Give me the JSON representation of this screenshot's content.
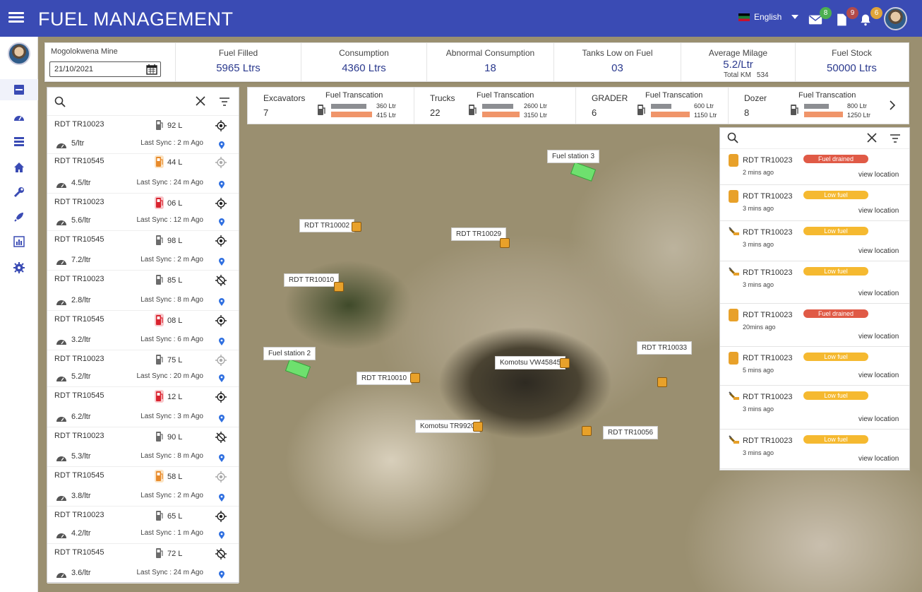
{
  "header": {
    "title": "FUEL MANAGEMENT",
    "language": "English",
    "badges": {
      "mail": "8",
      "docs": "9",
      "alerts": "6"
    }
  },
  "colors": {
    "primary": "#3a4bb4",
    "value": "#2b3a8e",
    "badge_mail": "#4caf50",
    "badge_docs": "#b24a4a",
    "badge_alerts": "#e0a43a",
    "fuel_drained": "#e05a46",
    "low_fuel": "#f5b930"
  },
  "sidebar": {
    "items": [
      {
        "icon": "list-icon"
      },
      {
        "icon": "dashboard-gauge-icon"
      },
      {
        "icon": "stack-icon"
      },
      {
        "icon": "home-icon"
      },
      {
        "icon": "wrench-icon"
      },
      {
        "icon": "rocket-icon"
      },
      {
        "icon": "bar-chart-icon"
      },
      {
        "icon": "gear-icon"
      }
    ]
  },
  "summary": {
    "mine": "Mogolokwena Mine",
    "date": "21/10/2021",
    "fuel_filled": {
      "label": "Fuel Filled",
      "value": "5965 Ltrs"
    },
    "consumption": {
      "label": "Consumption",
      "value": "4360 Ltrs"
    },
    "abnormal": {
      "label": "Abnormal Consumption",
      "value": "18"
    },
    "tanks_low": {
      "label": "Tanks Low on Fuel",
      "value": "03"
    },
    "avg_milage": {
      "label": "Average Milage",
      "value": "5.2/Ltr",
      "total_label": "Total KM",
      "total_value": "534"
    },
    "fuel_stock": {
      "label": "Fuel Stock",
      "value": "50000 Ltrs"
    }
  },
  "vehicles": [
    {
      "name": "RDT TR10023",
      "fuel": "92 L",
      "level": "full",
      "milage": "5/ltr",
      "sync": "Last Sync : 2 m Ago",
      "tracking": "on"
    },
    {
      "name": "RDT TR10545",
      "fuel": "44 L",
      "level": "medium",
      "milage": "4.5/ltr",
      "sync": "Last Sync : 24 m Ago",
      "tracking": "idle"
    },
    {
      "name": "RDT TR10023",
      "fuel": "06 L",
      "level": "low",
      "milage": "5.6/ltr",
      "sync": "Last Sync : 12 m Ago",
      "tracking": "on"
    },
    {
      "name": "RDT TR10545",
      "fuel": "98 L",
      "level": "full",
      "milage": "7.2/ltr",
      "sync": "Last Sync : 2 m Ago",
      "tracking": "on"
    },
    {
      "name": "RDT TR10023",
      "fuel": "85 L",
      "level": "full",
      "milage": "2.8/ltr",
      "sync": "Last Sync : 8 m Ago",
      "tracking": "off"
    },
    {
      "name": "RDT TR10545",
      "fuel": "08 L",
      "level": "low",
      "milage": "3.2/ltr",
      "sync": "Last Sync : 6 m Ago",
      "tracking": "on"
    },
    {
      "name": "RDT TR10023",
      "fuel": "75 L",
      "level": "full",
      "milage": "5.2/ltr",
      "sync": "Last Sync : 20 m Ago",
      "tracking": "idle"
    },
    {
      "name": "RDT TR10545",
      "fuel": "12 L",
      "level": "low",
      "milage": "6.2/ltr",
      "sync": "Last Sync : 3 m Ago",
      "tracking": "on"
    },
    {
      "name": "RDT TR10023",
      "fuel": "90 L",
      "level": "full",
      "milage": "5.3/ltr",
      "sync": "Last Sync : 8 m Ago",
      "tracking": "off"
    },
    {
      "name": "RDT TR10545",
      "fuel": "58 L",
      "level": "medium",
      "milage": "3.8/ltr",
      "sync": "Last Sync : 2 m Ago",
      "tracking": "idle"
    },
    {
      "name": "RDT TR10023",
      "fuel": "65 L",
      "level": "full",
      "milage": "4.2/ltr",
      "sync": "Last Sync : 1 m Ago",
      "tracking": "on"
    },
    {
      "name": "RDT TR10545",
      "fuel": "72 L",
      "level": "full",
      "milage": "3.6/ltr",
      "sync": "Last Sync : 24 m Ago",
      "tracking": "off"
    }
  ],
  "equipment": {
    "transaction_label": "Fuel Transcation",
    "items": [
      {
        "name": "Excavators",
        "count": "7",
        "v1": "360 Ltr",
        "v2": "415 Ltr",
        "f1": 0.87,
        "f2": 1.0
      },
      {
        "name": "Trucks",
        "count": "22",
        "v1": "2600 Ltr",
        "v2": "3150 Ltr",
        "f1": 0.83,
        "f2": 1.0
      },
      {
        "name": "GRADER",
        "count": "6",
        "v1": "600 Ltr",
        "v2": "1150 Ltr",
        "f1": 0.52,
        "f2": 1.0
      },
      {
        "name": "Dozer",
        "count": "8",
        "v1": "800 Ltr",
        "v2": "1250 Ltr",
        "f1": 0.64,
        "f2": 1.0
      }
    ]
  },
  "alerts": [
    {
      "name": "RDT TR10023",
      "time": "2 mins ago",
      "status": "Fuel drained",
      "kind": "drained",
      "icon": "truck-icon",
      "link": "view location"
    },
    {
      "name": "RDT TR10023",
      "time": "3 mins ago",
      "status": "Low fuel",
      "kind": "low",
      "icon": "truck-icon",
      "link": "view location"
    },
    {
      "name": "RDT TR10023",
      "time": "3 mins ago",
      "status": "Low fuel",
      "kind": "low",
      "icon": "excavator-icon",
      "link": "view location"
    },
    {
      "name": "RDT TR10023",
      "time": "3 mins ago",
      "status": "Low fuel",
      "kind": "low",
      "icon": "excavator-icon",
      "link": "view location"
    },
    {
      "name": "RDT TR10023",
      "time": "20mins ago",
      "status": "Fuel drained",
      "kind": "drained",
      "icon": "truck-icon",
      "link": "view location"
    },
    {
      "name": "RDT TR10023",
      "time": "5 mins ago",
      "status": "Low fuel",
      "kind": "low",
      "icon": "truck-icon",
      "link": "view location"
    },
    {
      "name": "RDT TR10023",
      "time": "3 mins ago",
      "status": "Low fuel",
      "kind": "low",
      "icon": "excavator-icon",
      "link": "view location"
    },
    {
      "name": "RDT TR10023",
      "time": "3 mins ago",
      "status": "Low fuel",
      "kind": "low",
      "icon": "excavator-icon",
      "link": "view location"
    }
  ],
  "map": {
    "stations": [
      "Fuel station 3",
      "Fuel station 2"
    ],
    "markers": [
      "RDT TR10002",
      "RDT TR10029",
      "RDT TR10010",
      "RDT TR10010",
      "Komotsu VW45845",
      "Komotsu TR9920",
      "RDT TR10033",
      "RDT TR10056"
    ]
  }
}
